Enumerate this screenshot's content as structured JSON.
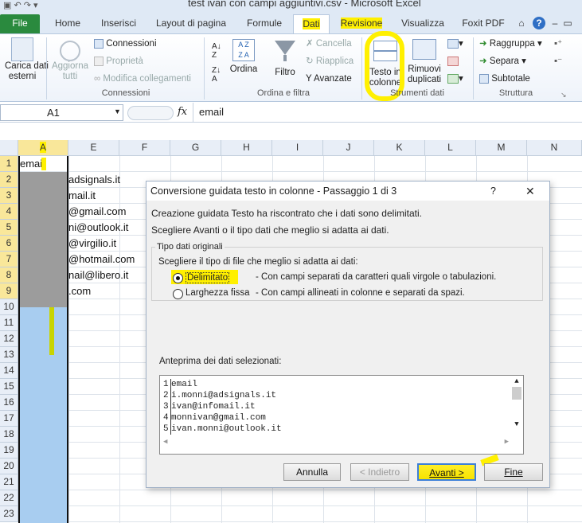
{
  "window": {
    "title": "test ivan con campi aggiuntivi.csv  -  Microsoft Excel"
  },
  "tabs": [
    "File",
    "Home",
    "Inserisci",
    "Layout di pagina",
    "Formule",
    "Dati",
    "Revisione",
    "Visualizza",
    "Foxit PDF"
  ],
  "ribbon": {
    "external": {
      "label1": "Carica dati",
      "label2": "esterni"
    },
    "refresh": {
      "label1": "Aggiorna",
      "label2": "tutti"
    },
    "connections": {
      "connessioni": "Connessioni",
      "proprieta": "Proprietà",
      "modifica": "Modifica collegamenti",
      "group": "Connessioni"
    },
    "sort": {
      "ordina": "Ordina",
      "filtro": "Filtro",
      "cancella": "Cancella",
      "riapplica": "Riapplica",
      "avanzate": "Avanzate",
      "group": "Ordina e filtra"
    },
    "tools": {
      "testo1": "Testo in",
      "testo2": "colonne",
      "rimuovi1": "Rimuovi",
      "rimuovi2": "duplicati",
      "group": "Strumenti dati"
    },
    "outline": {
      "raggruppa": "Raggruppa",
      "separa": "Separa",
      "subtotale": "Subtotale",
      "group": "Struttura"
    }
  },
  "formula_bar": {
    "name_box": "A1",
    "fx": "fx",
    "value": "email"
  },
  "columns": [
    "A",
    "E",
    "F",
    "G",
    "H",
    "I",
    "J",
    "K",
    "L",
    "M",
    "N"
  ],
  "rows": [
    "1",
    "2",
    "3",
    "4",
    "5",
    "6",
    "7",
    "8",
    "9",
    "10",
    "11",
    "12",
    "13",
    "14",
    "15",
    "16",
    "17",
    "18",
    "19",
    "20",
    "21",
    "22",
    "23"
  ],
  "cells": {
    "a1": "email",
    "e2": "adsignals.it",
    "e3": "mail.it",
    "e4": "@gmail.com",
    "e5": "ni@outlook.it",
    "e6": "@virgilio.it",
    "e7": "@hotmail.com",
    "e8": "nail@libero.it",
    "e9": ".com"
  },
  "dialog": {
    "title": "Conversione guidata testo in colonne - Passaggio 1 di 3",
    "help": "?",
    "close": "✕",
    "intro1": "Creazione guidata Testo ha riscontrato che i dati sono delimitati.",
    "intro2": "Scegliere Avanti o il tipo dati che meglio si adatta ai dati.",
    "group_title": "Tipo dati originali",
    "group_prompt": "Scegliere il tipo di file che meglio si adatta ai dati:",
    "opt1_label": "Delimitato",
    "opt1_desc": "- Con campi separati da caratteri quali virgole o tabulazioni.",
    "opt2_label": "Larghezza fissa",
    "opt2_desc": "- Con campi allineati in colonne e separati da spazi.",
    "preview_label": "Anteprima dei dati selezionati:",
    "preview_rows": [
      {
        "n": "1",
        "text": "email"
      },
      {
        "n": "2",
        "text": "i.monni@adsignals.it"
      },
      {
        "n": "3",
        "text": "ivan@infomail.it"
      },
      {
        "n": "4",
        "text": "monnivan@gmail.com"
      },
      {
        "n": "5",
        "text": "ivan.monni@outlook.it"
      }
    ],
    "buttons": {
      "annulla": "Annulla",
      "indietro": "< Indietro",
      "avanti": "Avanti >",
      "fine": "Fine"
    }
  }
}
